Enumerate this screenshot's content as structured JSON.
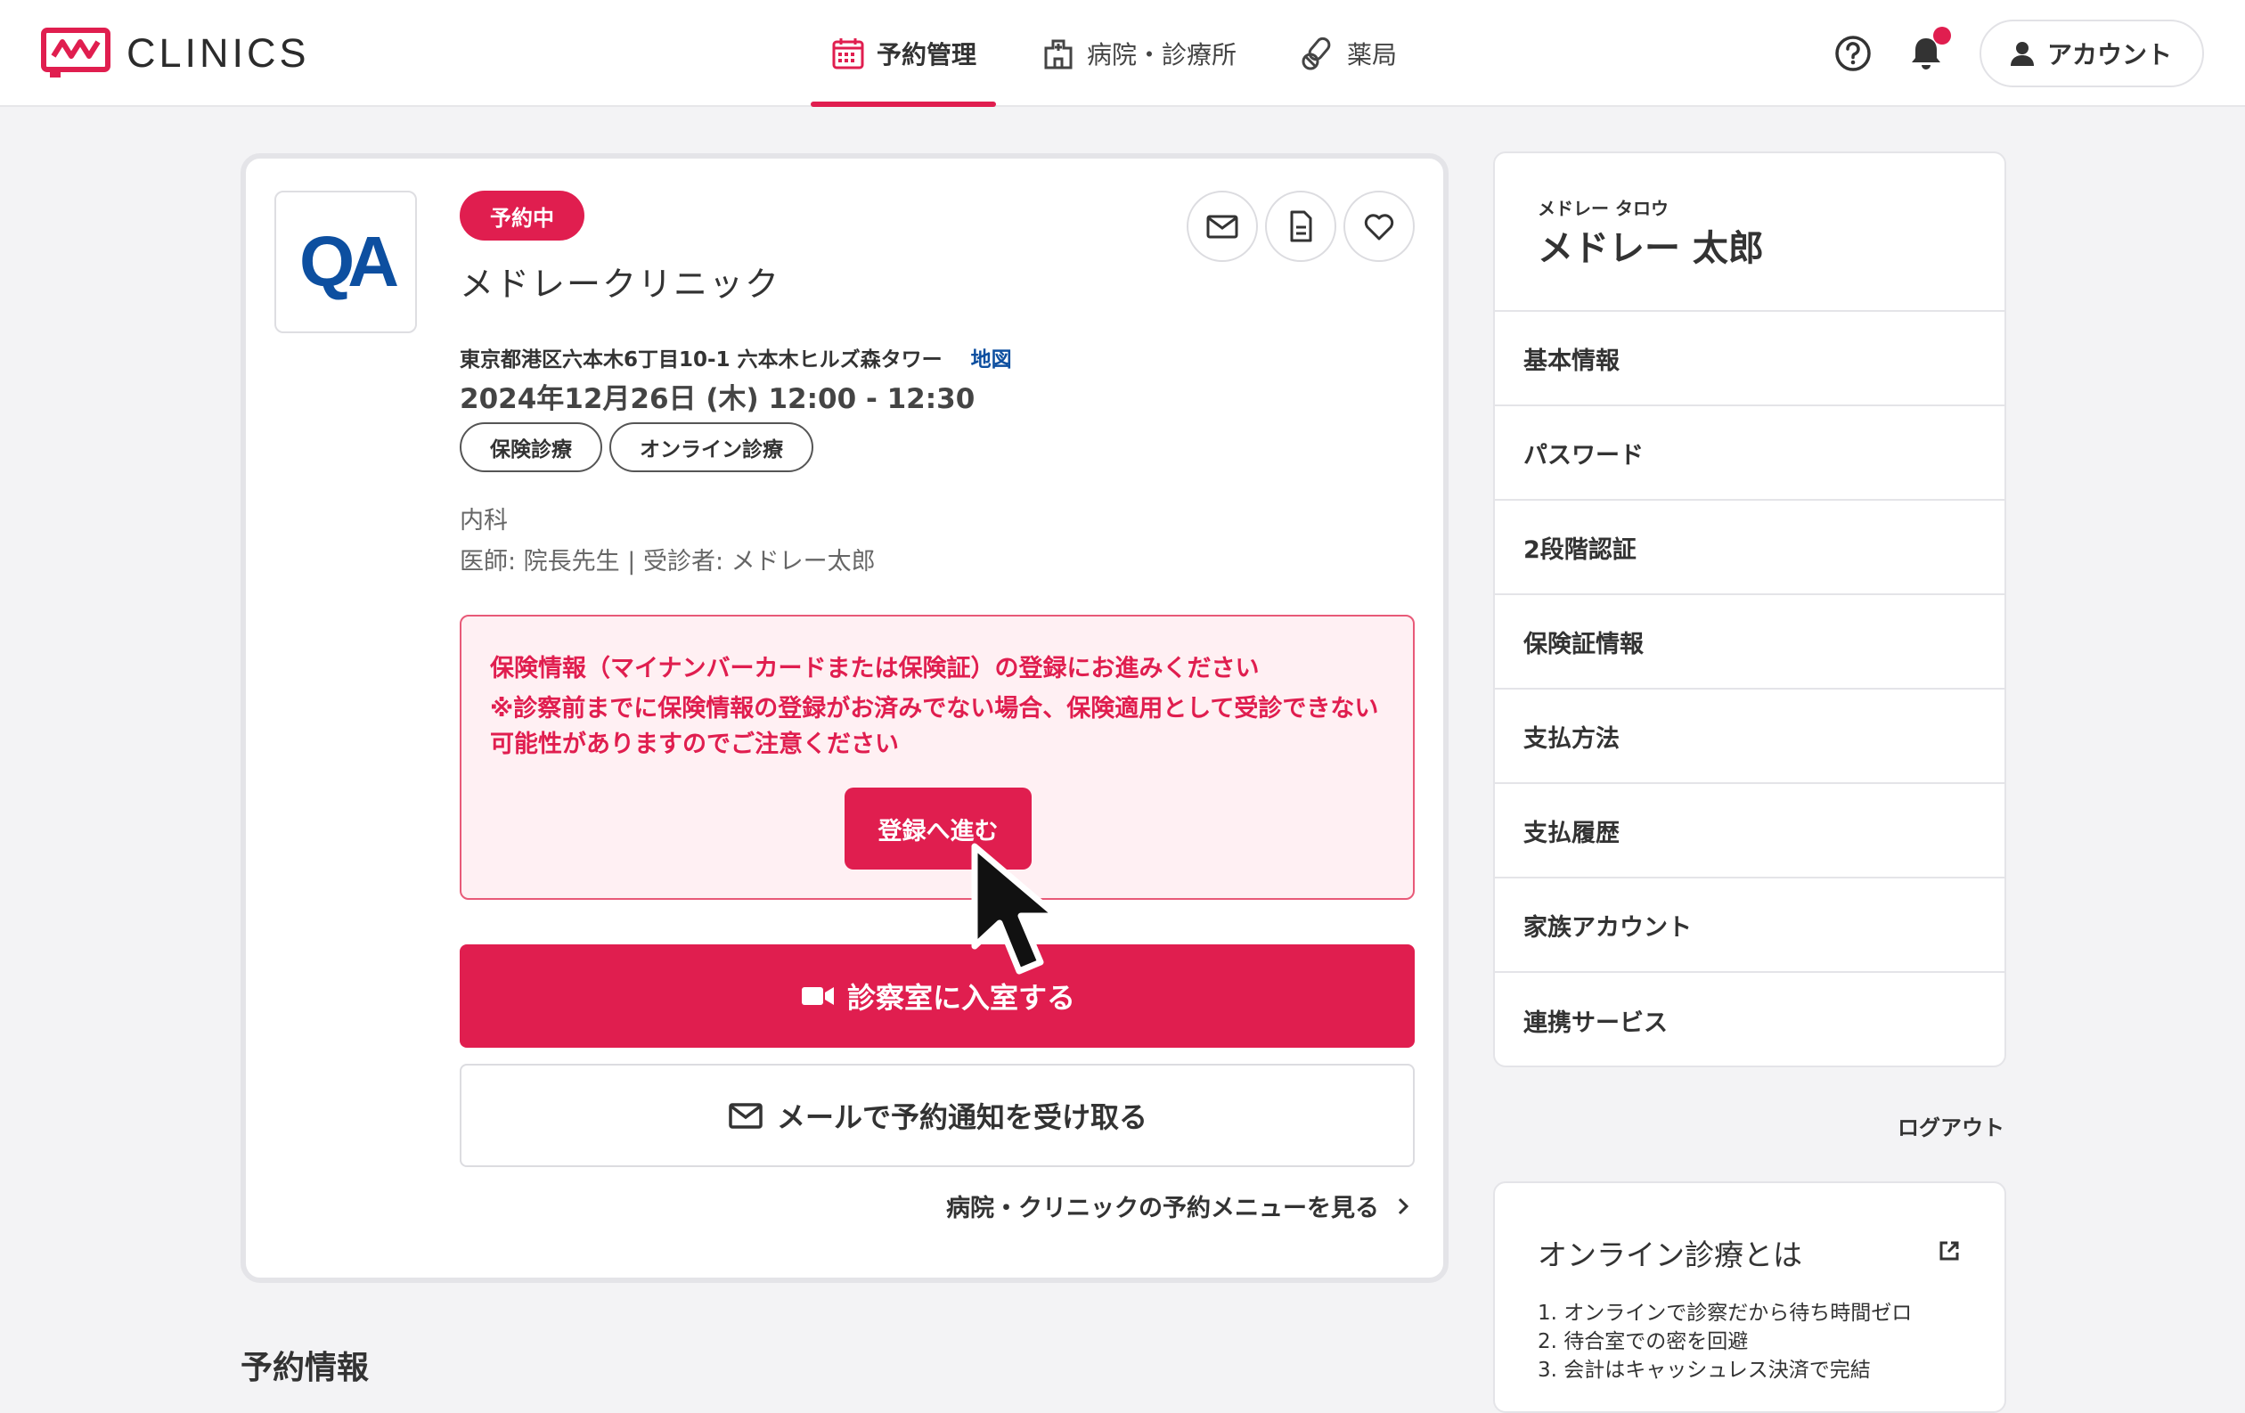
{
  "header": {
    "logo_text": "CLINICS",
    "nav": [
      {
        "label": "予約管理",
        "icon": "calendar-icon",
        "active": true
      },
      {
        "label": "病院・診療所",
        "icon": "hospital-icon",
        "active": false
      },
      {
        "label": "薬局",
        "icon": "pill-icon",
        "active": false
      }
    ],
    "account_label": "アカウント"
  },
  "reservation": {
    "logo_text": "QA",
    "status": "予約中",
    "clinic_name": "メドレークリニック",
    "address": "東京都港区六本木6丁目10-1 六本木ヒルズ森タワー",
    "map_link": "地図",
    "datetime": "2024年12月26日 (木) 12:00 - 12:30",
    "tags": [
      "保険診療",
      "オンライン診療"
    ],
    "department": "内科",
    "doctor_line": "医師: 院長先生 | 受診者: メドレー太郎",
    "alert": {
      "title": "保険情報（マイナンバーカードまたは保険証）の登録にお進みください",
      "note": "※診察前までに保険情報の登録がお済みでない場合、保険適用として受診できない可能性がありますのでご注意ください",
      "button": "登録へ進む"
    },
    "enter_button": "診察室に入室する",
    "mail_button": "メールで予約通知を受け取る",
    "menu_link": "病院・クリニックの予約メニューを見る"
  },
  "section_title": "予約情報",
  "sidebar": {
    "kana": "メドレー タロウ",
    "name": "メドレー 太郎",
    "items": [
      {
        "label": "基本情報"
      },
      {
        "label": "パスワード"
      },
      {
        "label": "2段階認証"
      },
      {
        "label": "保険証情報"
      },
      {
        "label": "支払方法"
      },
      {
        "label": "支払履歴"
      },
      {
        "label": "家族アカウント"
      },
      {
        "label": "連携サービス"
      }
    ],
    "logout": "ログアウト"
  },
  "info": {
    "title": "オンライン診療とは",
    "items": [
      "1. オンラインで診察だから待ち時間ゼロ",
      "2. 待合室での密を回避",
      "3. 会計はキャッシュレス決済で完結"
    ]
  },
  "colors": {
    "brand": "#e01e4f",
    "link": "#0d4fa0",
    "alert_bg": "#fff0f3"
  }
}
